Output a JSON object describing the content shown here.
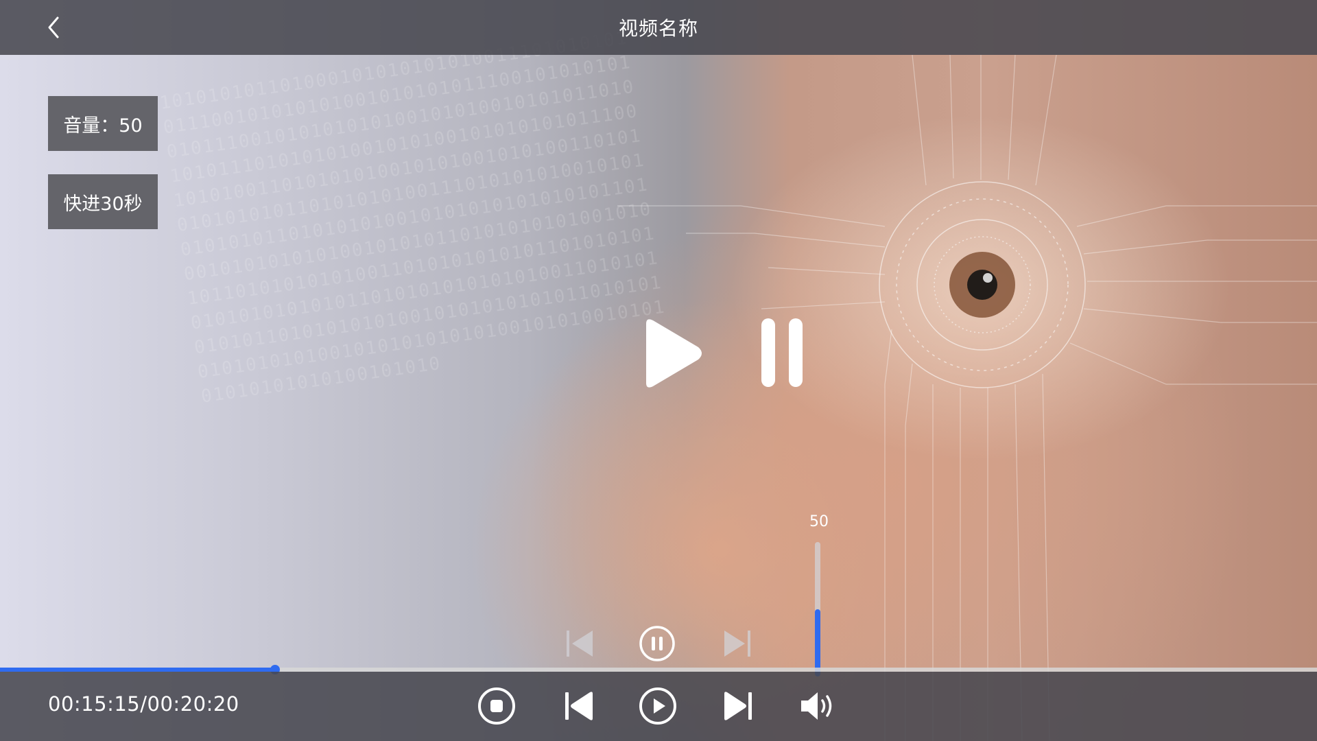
{
  "header": {
    "title": "视频名称",
    "back_icon": "chevron-left-icon"
  },
  "overlay": {
    "volume_badge": "音量：50",
    "fast_forward_badge": "快进30秒",
    "center_controls": {
      "play_icon": "play-icon",
      "pause_icon": "pause-icon"
    },
    "mini_controls": {
      "prev_icon": "skip-back-icon",
      "pause_icon": "pause-circle-icon",
      "next_icon": "skip-forward-icon"
    }
  },
  "volume": {
    "value": 50,
    "label": "50",
    "max": 100
  },
  "playback": {
    "current_time": "00:15:15",
    "total_time": "00:20:20",
    "time_display": "00:15:15/00:20:20",
    "progress": 0.209
  },
  "bottom_controls": {
    "stop_icon": "stop-circle-icon",
    "prev_icon": "skip-back-icon",
    "play_icon": "play-circle-icon",
    "next_icon": "skip-forward-icon",
    "volume_icon": "volume-icon"
  },
  "colors": {
    "accent": "#2f6bf0",
    "bar_bg": "#484850",
    "track": "#d7d7d7"
  }
}
